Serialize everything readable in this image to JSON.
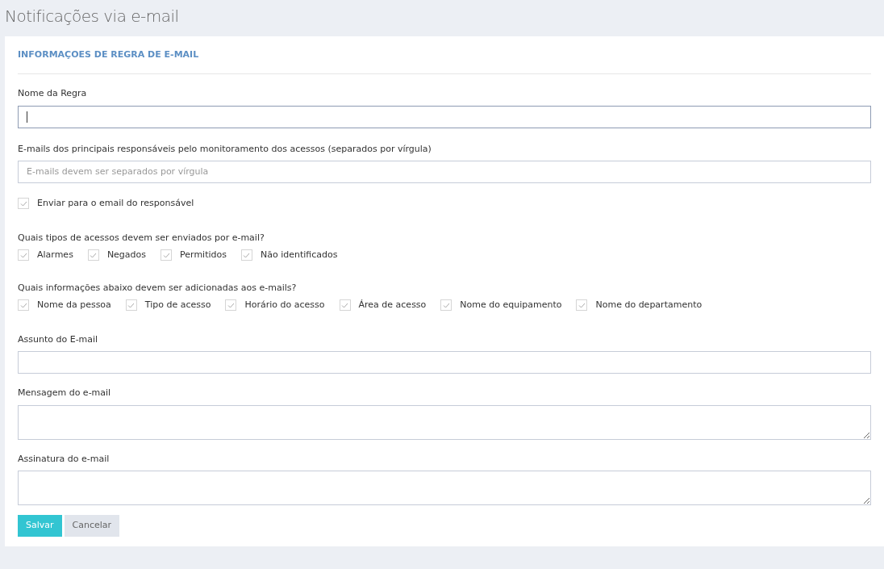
{
  "page_title": "Notificações via e-mail",
  "section_title": "INFORMAÇOES DE REGRA DE E-MAIL",
  "fields": [
    {
      "label": "Nome da Regra",
      "kind": "text",
      "focused": true
    },
    {
      "label": "E-mails dos principais responsáveis pelo monitoramento dos acessos (separados por vírgula)",
      "kind": "text",
      "focused": false,
      "placeholder": "E-mails devem ser separados por vírgula"
    }
  ],
  "send_to_responsible": {
    "label": "Enviar para o email do responsável",
    "checked": true
  },
  "access_types": {
    "question": "Quais tipos de acessos devem ser enviados por e-mail?",
    "options": [
      {
        "label": "Alarmes",
        "checked": true
      },
      {
        "label": "Negados",
        "checked": true
      },
      {
        "label": "Permitidos",
        "checked": true
      },
      {
        "label": "Não identificados",
        "checked": true
      }
    ]
  },
  "info_fields": {
    "question": "Quais informações abaixo devem ser adicionadas aos e-mails?",
    "options": [
      {
        "label": "Nome da pessoa",
        "checked": true
      },
      {
        "label": "Tipo de acesso",
        "checked": true
      },
      {
        "label": "Horário do acesso",
        "checked": true
      },
      {
        "label": "Área de acesso",
        "checked": true
      },
      {
        "label": "Nome do equipamento",
        "checked": true
      },
      {
        "label": "Nome do departamento",
        "checked": true
      }
    ]
  },
  "message_fields": [
    {
      "label": "Assunto do E-mail",
      "kind": "text",
      "focused": false
    },
    {
      "label": "Mensagem do e-mail",
      "kind": "textarea",
      "focused": false
    },
    {
      "label": "Assinatura do e-mail",
      "kind": "textarea",
      "focused": false
    }
  ],
  "buttons": [
    {
      "label": "Salvar",
      "kind": "primary"
    },
    {
      "label": "Cancelar",
      "kind": "secondary"
    }
  ]
}
